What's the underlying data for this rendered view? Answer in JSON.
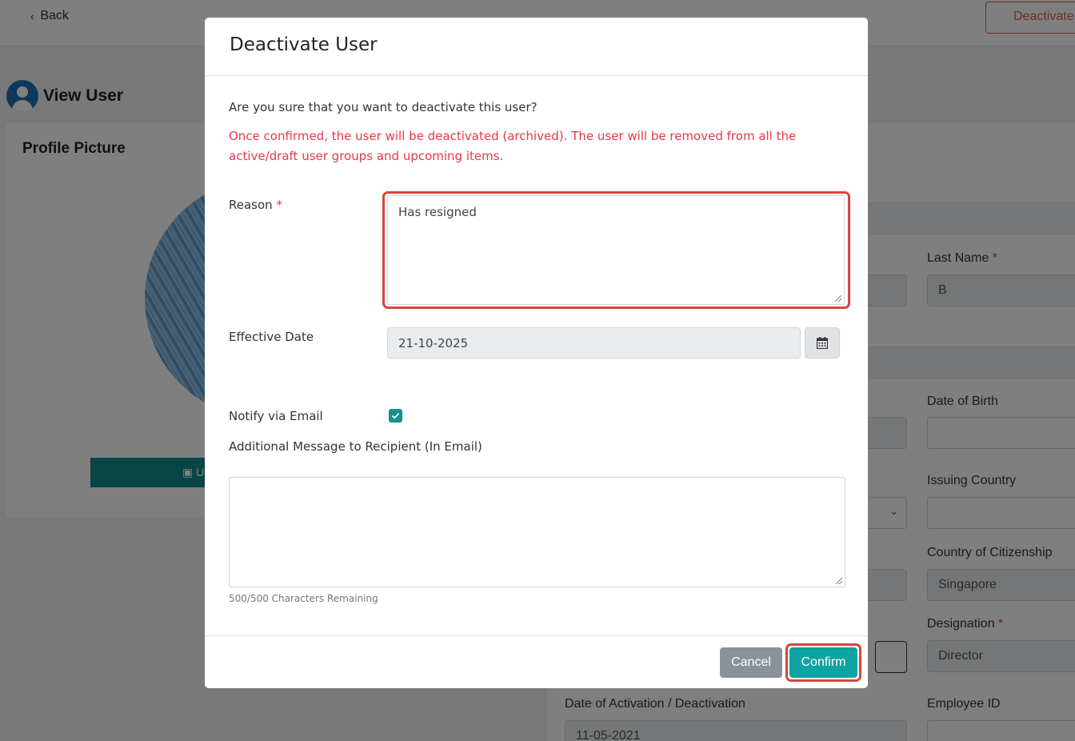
{
  "topbar": {
    "back_label": "Back",
    "deactivate_label": "Deactivate"
  },
  "page": {
    "title": "View User"
  },
  "profile": {
    "title": "Profile Picture",
    "upload_label": "U"
  },
  "right_panel": {
    "last_name_label": "Last Name",
    "last_name_value": "B",
    "dob_label": "Date of Birth",
    "issuing_country_label": "Issuing Country",
    "citizenship_label": "Country of Citizenship",
    "citizenship_value": "Singapore",
    "designation_label": "Designation",
    "designation_value": "Director",
    "activation_label": "Date of Activation / Deactivation",
    "activation_value": "11-05-2021",
    "employee_id_label": "Employee ID",
    "required_mark": "*"
  },
  "modal": {
    "title": "Deactivate User",
    "question": "Are you sure that you want to deactivate this user?",
    "warning": "Once confirmed, the user will be deactivated (archived). The user will be removed from all the active/draft user groups and upcoming items.",
    "reason_label": "Reason",
    "reason_value": "Has resigned",
    "effective_date_label": "Effective Date",
    "effective_date_value": "21-10-2025",
    "notify_label": "Notify via Email",
    "notify_checked": true,
    "additional_label": "Additional Message to Recipient (In Email)",
    "additional_value": "",
    "char_count": "500/500 Characters Remaining",
    "cancel_label": "Cancel",
    "confirm_label": "Confirm"
  },
  "colors": {
    "accent": "#10a3a3",
    "danger": "#e8374b",
    "highlight": "#d9453c"
  }
}
